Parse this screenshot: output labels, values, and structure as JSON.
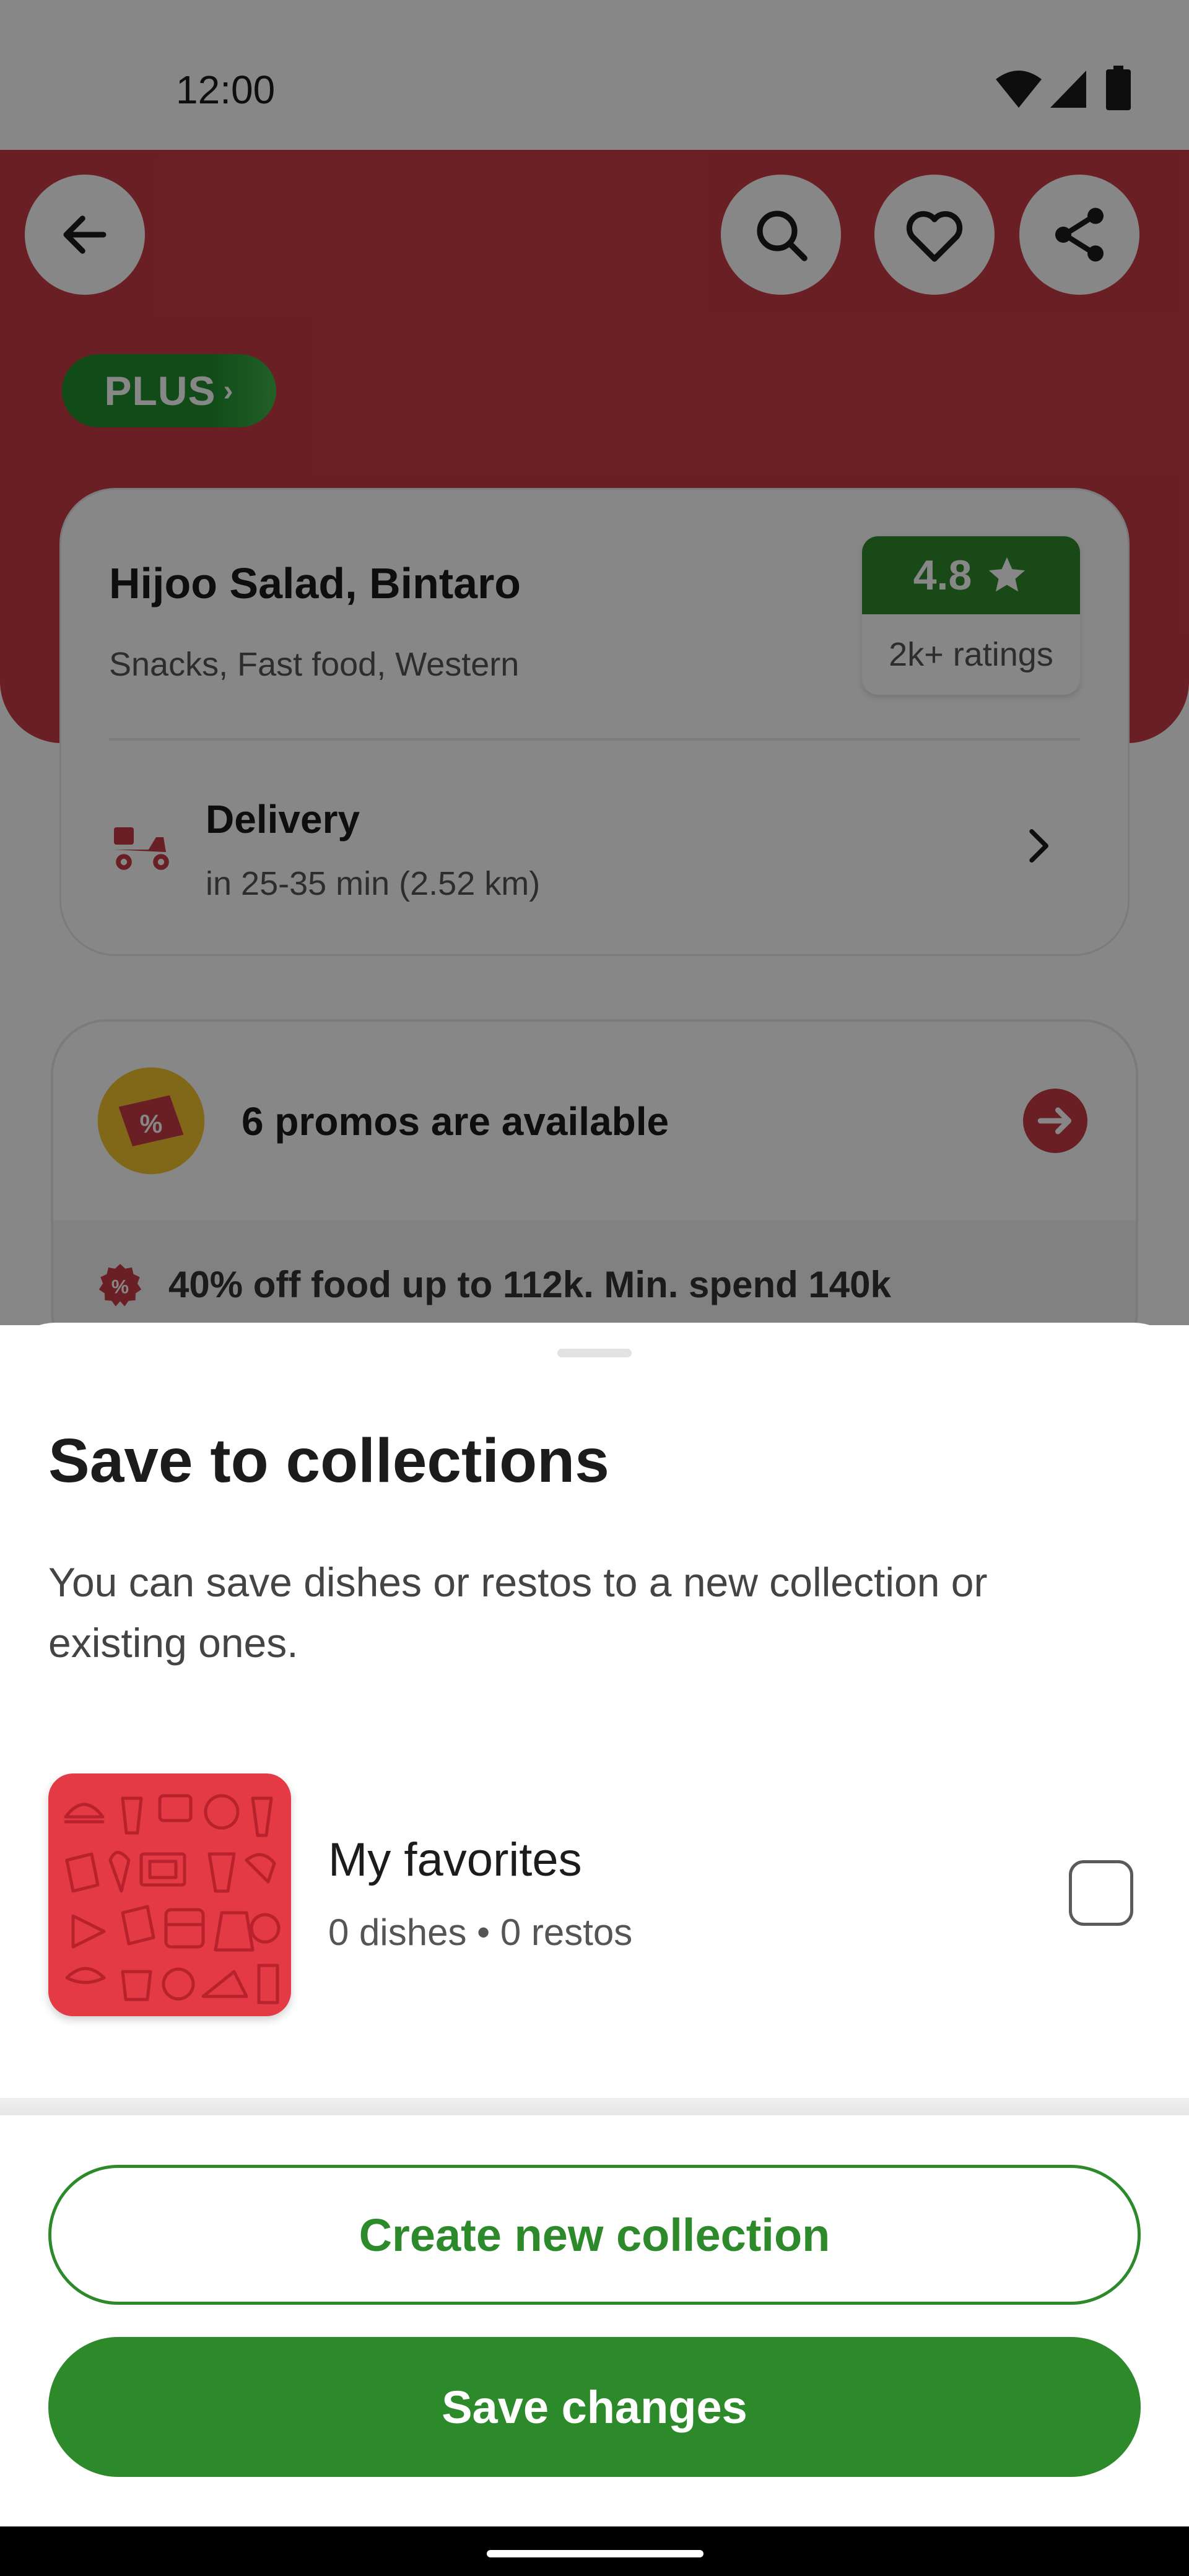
{
  "status_bar": {
    "time": "12:00"
  },
  "header": {
    "plus_badge": "PLUS",
    "back_icon": "arrow-left-icon",
    "search_icon": "search-icon",
    "favorite_icon": "heart-icon",
    "share_icon": "share-icon"
  },
  "restaurant": {
    "name": "Hijoo Salad, Bintaro",
    "cuisines": "Snacks, Fast food, Western",
    "rating": "4.8",
    "ratings_count": "2k+ ratings",
    "delivery_label": "Delivery",
    "delivery_time": "in 25-35 min (2.52 km)"
  },
  "promos": {
    "title": "6 promos are available",
    "first_promo": "40% off food up to 112k. Min. spend 140k"
  },
  "sheet": {
    "title": "Save to collections",
    "description": "You can save dishes or restos to a new collection or existing ones.",
    "collections": [
      {
        "name": "My favorites",
        "meta": "0 dishes • 0 restos",
        "checked": false
      }
    ],
    "create_button": "Create new collection",
    "save_button": "Save changes"
  },
  "colors": {
    "brand_red": "#c83c44",
    "brand_green": "#2d8a2b",
    "thumb_red": "#e43a45"
  }
}
